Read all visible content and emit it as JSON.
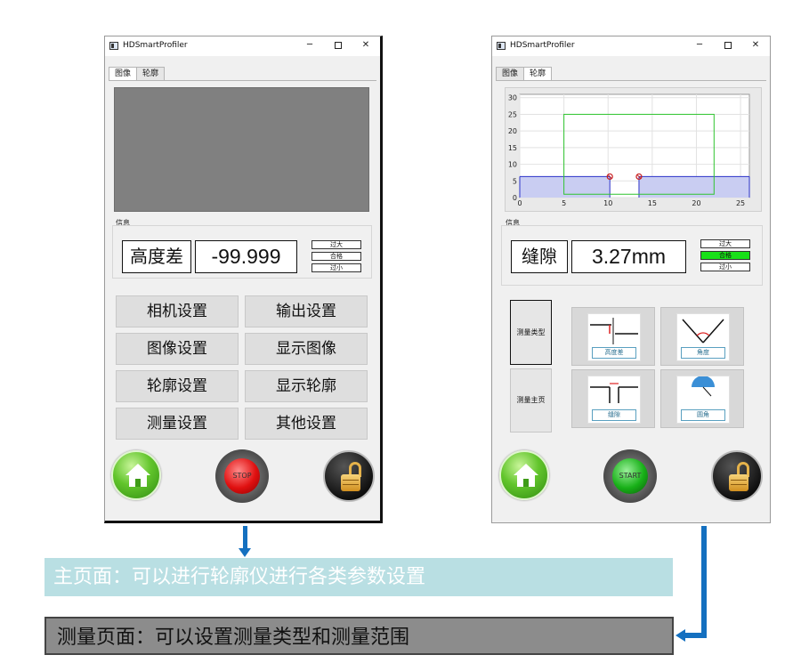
{
  "left_window": {
    "title": "HDSmartProfiler",
    "window_controls": [
      "─",
      "✕"
    ],
    "tabs": [
      "图像",
      "轮廓"
    ],
    "active_tab": 0,
    "group_label": "信息",
    "measure_label": "高度差",
    "measure_value": "-99.999",
    "tolerance": [
      "过大",
      "合格",
      "过小"
    ],
    "menu_buttons": [
      "相机设置",
      "输出设置",
      "图像设置",
      "显示图像",
      "轮廓设置",
      "显示轮廓",
      "测量设置",
      "其他设置"
    ],
    "home_icon": "home-icon",
    "stop_button_label": "STOP",
    "lock_icon": "unlock-icon"
  },
  "right_window": {
    "title": "HDSmartProfiler",
    "window_controls": [
      "─",
      "✕"
    ],
    "tabs": [
      "图像",
      "轮廓"
    ],
    "active_tab": 1,
    "group_label": "信息",
    "measure_label": "缝隙",
    "measure_value": "3.27mm",
    "tolerance": [
      "过大",
      "合格",
      "过小"
    ],
    "tolerance_active": 1,
    "side_buttons": [
      "测量类型",
      "测量主页"
    ],
    "type_tiles": [
      "高度差",
      "角度",
      "缝隙",
      "圆角"
    ],
    "home_icon": "home-icon",
    "start_button_label": "START",
    "lock_icon": "unlock-icon",
    "colors": {
      "pass": "#18e018",
      "profile_fill": "#c9cdf2",
      "profile_line": "#2b32c8",
      "roi": "#2fc42f",
      "marker": "#c81e1e"
    }
  },
  "chart_data": {
    "type": "area",
    "x_ticks": [
      "0",
      "5",
      "10",
      "15",
      "20",
      "25"
    ],
    "y_ticks": [
      "0",
      "5",
      "10",
      "15",
      "20",
      "25",
      "30"
    ],
    "xlim": [
      0,
      26
    ],
    "ylim": [
      0,
      31
    ],
    "series": [
      {
        "x": [
          0,
          10.2
        ],
        "y": [
          6.3,
          6.3
        ]
      },
      {
        "x": [
          13.5,
          26
        ],
        "y": [
          6.3,
          6.3
        ]
      }
    ],
    "gap_markers": [
      {
        "x": 10.2,
        "y": 6.3
      },
      {
        "x": 13.5,
        "y": 6.3
      }
    ],
    "roi": {
      "x": [
        5,
        22
      ],
      "y": [
        1,
        25
      ]
    },
    "grid": true
  },
  "banners": {
    "main": "主页面：可以进行轮廓仪进行各类参数设置",
    "measure": "测量页面：可以设置测量类型和测量范围"
  }
}
